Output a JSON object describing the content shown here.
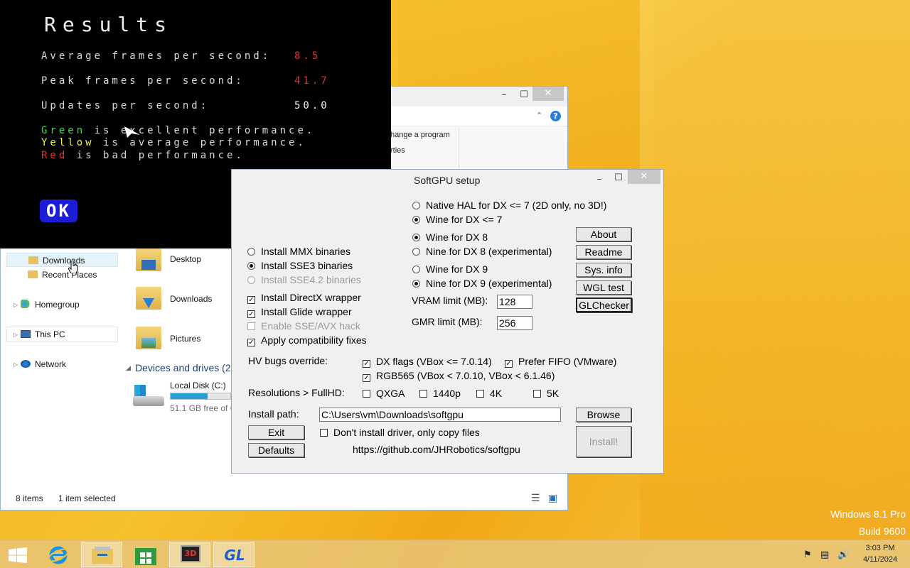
{
  "results": {
    "title": "Results",
    "rows": [
      {
        "label": "Average frames per second:",
        "value": "8.5"
      },
      {
        "label": "Peak frames per second:",
        "value": "41.7"
      },
      {
        "label": "Updates per second:",
        "value": "50.0"
      }
    ],
    "legend": [
      {
        "word": "Green",
        "rest": " is excellent performance."
      },
      {
        "word": "Yellow",
        "rest": " is average performance."
      },
      {
        "word": "Red",
        "rest": " is bad performance."
      }
    ],
    "ok_label": "OK"
  },
  "explorer": {
    "ribbon_change_program": "hange a program",
    "ribbon_properties": "rties",
    "help": "?",
    "nav": {
      "downloads": "Downloads",
      "recent_places": "Recent Places",
      "homegroup": "Homegroup",
      "this_pc": "This PC",
      "network": "Network"
    },
    "items": {
      "desktop": "Desktop",
      "downloads": "Downloads",
      "pictures": "Pictures"
    },
    "devices_header": "Devices and drives (2",
    "drive": {
      "name": "Local Disk (C:)",
      "free": "51.1 GB free of 6",
      "used_fraction": 0.62
    },
    "status": {
      "count": "8 items",
      "selected": "1 item selected"
    }
  },
  "softgpu": {
    "title": "SoftGPU setup",
    "options_left": [
      {
        "label": "Install MMX binaries",
        "type": "radio",
        "checked": false,
        "disabled": false
      },
      {
        "label": "Install SSE3 binaries",
        "type": "radio",
        "checked": true,
        "disabled": false
      },
      {
        "label": "Install SSE4.2 binaries",
        "type": "radio",
        "checked": false,
        "disabled": true
      },
      {
        "label": "Install DirectX wrapper",
        "type": "check",
        "checked": true,
        "disabled": false
      },
      {
        "label": "Install Glide wrapper",
        "type": "check",
        "checked": true,
        "disabled": false
      },
      {
        "label": "Enable SSE/AVX hack",
        "type": "check",
        "checked": false,
        "disabled": true
      },
      {
        "label": "Apply compatibility fixes",
        "type": "check",
        "checked": true,
        "disabled": false
      }
    ],
    "options_right": [
      {
        "label": "Native HAL for DX <= 7 (2D only, no 3D!)",
        "checked": false
      },
      {
        "label": "Wine for DX <= 7",
        "checked": true
      },
      {
        "label": "Wine for DX 8",
        "checked": true
      },
      {
        "label": "Nine for DX 8 (experimental)",
        "checked": false
      },
      {
        "label": "Wine for DX 9",
        "checked": false
      },
      {
        "label": "Nine for DX 9 (experimental)",
        "checked": true
      }
    ],
    "vram_label": "VRAM limit (MB):",
    "vram_value": "128",
    "gmr_label": "GMR limit (MB):",
    "gmr_value": "256",
    "buttons": {
      "about": "About",
      "readme": "Readme",
      "sysinfo": "Sys. info",
      "wgltest": "WGL test",
      "glchecker": "GLChecker",
      "browse": "Browse",
      "install": "Install!",
      "exit": "Exit",
      "defaults": "Defaults"
    },
    "hv_label": "HV bugs override:",
    "hv_options": [
      {
        "label": "DX flags (VBox <= 7.0.14)",
        "checked": true
      },
      {
        "label": "Prefer FIFO (VMware)",
        "checked": true
      },
      {
        "label": "RGB565 (VBox < 7.0.10, VBox < 6.1.46)",
        "checked": true
      }
    ],
    "res_label": "Resolutions > FullHD:",
    "res_options": [
      {
        "label": "QXGA",
        "checked": false
      },
      {
        "label": "1440p",
        "checked": false
      },
      {
        "label": "4K",
        "checked": false
      },
      {
        "label": "5K",
        "checked": false
      }
    ],
    "path_label": "Install path:",
    "path_value": "C:\\Users\\vm\\Downloads\\softgpu",
    "copy_only_label": "Don't install driver, only copy files",
    "copy_only_checked": false,
    "url": "https://github.com/JHRobotics/softgpu"
  },
  "desktop": {
    "watermark_line1": "Windows 8.1 Pro",
    "watermark_line2": "Build 9600"
  },
  "taskbar": {
    "time": "3:03 PM",
    "date": "4/11/2024",
    "glchecker_icon_text": "GL",
    "3d_icon_text": "3D"
  },
  "colors": {
    "results_bg": "#000000",
    "ok_blue": "#1d1dd8",
    "value_red": "#e03030",
    "legend_green": "#30e040",
    "legend_yellow": "#f0f040",
    "accent_blue": "#26a0da"
  }
}
